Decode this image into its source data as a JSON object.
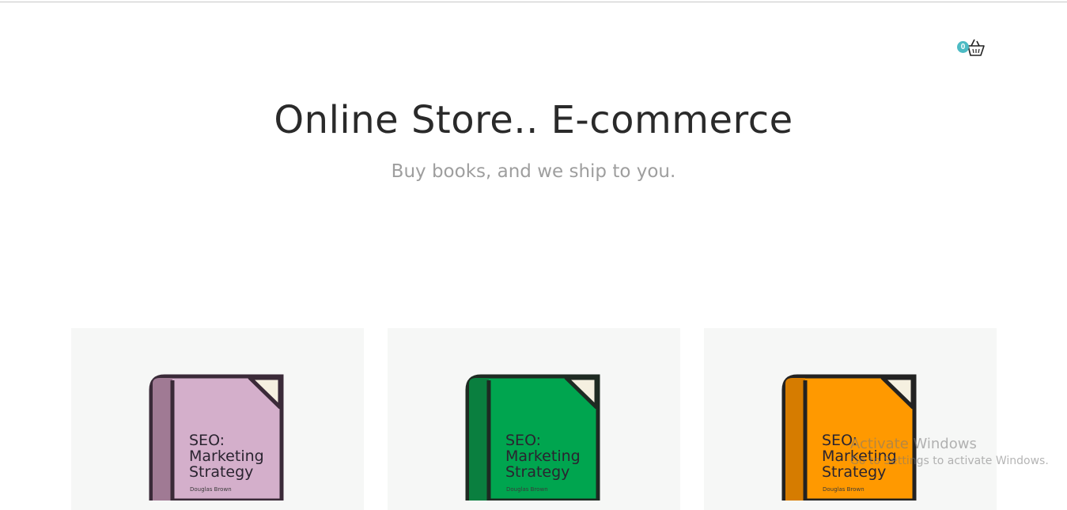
{
  "cart": {
    "count": "0",
    "icon": "basket-icon"
  },
  "hero": {
    "title": "Online Store.. E-commerce",
    "subtitle": "Buy books, and we ship to you."
  },
  "products": [
    {
      "line1": "SEO:",
      "line2": "Marketing",
      "line3": "Strategy",
      "author": "Douglas Brown",
      "cover_color": "#d4afcb",
      "spine_color": "#a07a94"
    },
    {
      "line1": "SEO:",
      "line2": "Marketing",
      "line3": "Strategy",
      "author": "Douglas Brown",
      "cover_color": "#00a54f",
      "spine_color": "#0a7f3f"
    },
    {
      "line1": "SEO:",
      "line2": "Marketing",
      "line3": "Strategy",
      "author": "Douglas Brown",
      "cover_color": "#ff9900",
      "spine_color": "#d67c00"
    }
  ],
  "watermark": {
    "line1": "Activate Windows",
    "line2": "Go to Settings to activate Windows."
  }
}
